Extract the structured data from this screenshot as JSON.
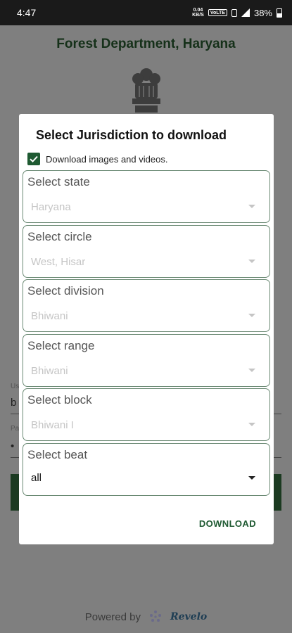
{
  "status_bar": {
    "time": "4:47",
    "speed": "0.04",
    "speed_unit": "KB/S",
    "volte": "VoLTE",
    "battery": "38%"
  },
  "app": {
    "title": "Forest Department, Haryana",
    "username_label": "Us",
    "username_value": "b",
    "password_label": "Pa",
    "password_value": "•",
    "powered_by": "Powered by",
    "brand": "Revelo"
  },
  "dialog": {
    "title": "Select Jurisdiction to download",
    "checkbox_label": "Download images and videos.",
    "checkbox_checked": true,
    "fields": [
      {
        "label": "Select state",
        "value": "Haryana"
      },
      {
        "label": "Select circle",
        "value": "West, Hisar"
      },
      {
        "label": "Select division",
        "value": "Bhiwani"
      },
      {
        "label": "Select range",
        "value": "Bhiwani"
      },
      {
        "label": "Select block",
        "value": "Bhiwani I"
      },
      {
        "label": "Select beat",
        "value": "all"
      }
    ],
    "download_label": "DOWNLOAD"
  },
  "colors": {
    "accent": "#1f5a32",
    "title_green": "#153019",
    "scrim": "#7f7f7f"
  }
}
